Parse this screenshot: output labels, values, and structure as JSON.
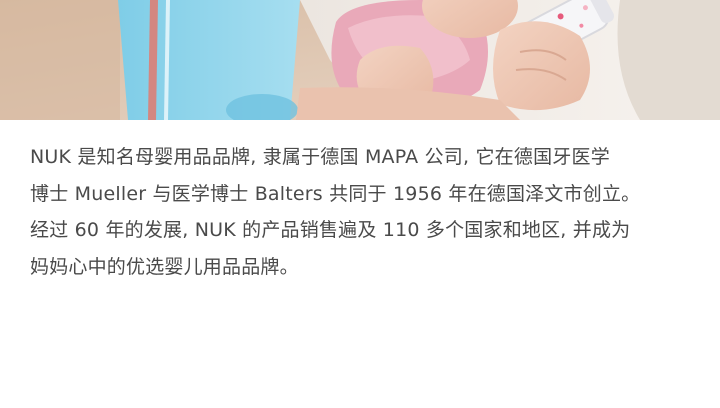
{
  "article": {
    "lines": [
      "NUK 是知名母婴用品品牌, 隶属于德国 MAPA 公司, 它在德国牙医学",
      "博士 Mueller 与医学博士 Balters 共同于 1956 年在德国泽文市创立。",
      "经过 60 年的发展, NUK 的产品销售遍及 110 多个国家和地区, 并成为",
      "妈妈心中的优选婴儿用品品牌。"
    ]
  },
  "colors": {
    "text": "#4a4a4a",
    "background": "#ffffff",
    "blanket": "#8fd3ea",
    "wall": "#dcc3ad"
  }
}
